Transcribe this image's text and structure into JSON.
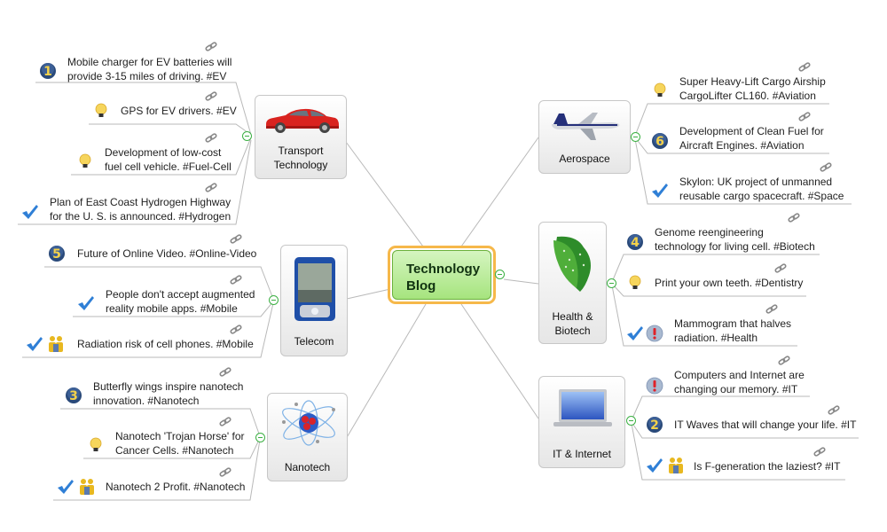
{
  "central": {
    "title_line1": "Technology",
    "title_line2": "Blog"
  },
  "topics": {
    "transport": {
      "label_line1": "Transport",
      "label_line2": "Technology",
      "image": "red-car",
      "items": [
        {
          "line1": "Mobile charger for EV batteries will",
          "line2": "provide 3-15 miles of driving. #EV",
          "icons": [
            "priority-1"
          ]
        },
        {
          "line1": "GPS for EV drivers. #EV",
          "icons": [
            "idea-bulb"
          ]
        },
        {
          "line1": "Development of low-cost",
          "line2": "fuel cell vehicle. #Fuel-Cell",
          "icons": [
            "idea-bulb"
          ]
        },
        {
          "line1": "Plan of East Coast Hydrogen Highway",
          "line2": "for the U. S. is announced. #Hydrogen",
          "icons": [
            "checkmark"
          ]
        }
      ]
    },
    "telecom": {
      "label_line1": "Telecom",
      "image": "pda-device",
      "items": [
        {
          "line1": "Future of Online Video. #Online-Video",
          "icons": [
            "priority-5"
          ]
        },
        {
          "line1": "People don't accept augmented",
          "line2": "reality mobile apps. #Mobile",
          "icons": [
            "checkmark"
          ]
        },
        {
          "line1": "Radiation risk of cell phones. #Mobile",
          "icons": [
            "checkmark",
            "people"
          ]
        }
      ]
    },
    "nanotech": {
      "label_line1": "Nanotech",
      "image": "atom",
      "items": [
        {
          "line1": "Butterfly wings inspire nanotech",
          "line2": "innovation. #Nanotech",
          "icons": [
            "priority-3"
          ]
        },
        {
          "line1": "Nanotech 'Trojan Horse' for",
          "line2": "Cancer Cells. #Nanotech",
          "icons": [
            "idea-bulb"
          ]
        },
        {
          "line1": "Nanotech 2 Profit. #Nanotech",
          "icons": [
            "checkmark",
            "people"
          ]
        }
      ]
    },
    "aerospace": {
      "label_line1": "Aerospace",
      "image": "airplane",
      "items": [
        {
          "line1": "Super Heavy-Lift Cargo Airship",
          "line2": "CargoLifter CL160. #Aviation",
          "icons": [
            "idea-bulb"
          ]
        },
        {
          "line1": "Development of Clean Fuel for",
          "line2": "Aircraft Engines. #Aviation",
          "icons": [
            "priority-6"
          ]
        },
        {
          "line1": "Skylon: UK project of unmanned",
          "line2": "reusable cargo spacecraft. #Space",
          "icons": [
            "checkmark"
          ]
        }
      ]
    },
    "health": {
      "label_line1": "Health &",
      "label_line2": "Biotech",
      "image": "green-leaves",
      "items": [
        {
          "line1": "Genome reengineering",
          "line2": "technology for living cell. #Biotech",
          "icons": [
            "priority-4"
          ]
        },
        {
          "line1": "Print your own teeth. #Dentistry",
          "icons": [
            "idea-bulb"
          ]
        },
        {
          "line1": "Mammogram that halves",
          "line2": "radiation. #Health",
          "icons": [
            "checkmark",
            "alert"
          ]
        }
      ]
    },
    "it": {
      "label_line1": "IT & Internet",
      "image": "laptop",
      "items": [
        {
          "line1": "Computers and Internet are",
          "line2": "changing our memory. #IT",
          "icons": [
            "alert"
          ]
        },
        {
          "line1": "IT Waves that will change your life. #IT",
          "icons": [
            "priority-2"
          ]
        },
        {
          "line1": "Is F-generation the laziest? #IT",
          "icons": [
            "checkmark",
            "people"
          ]
        }
      ]
    }
  },
  "numbers": {
    "p1": "1",
    "p2": "2",
    "p3": "3",
    "p4": "4",
    "p5": "5",
    "p6": "6"
  },
  "colors": {
    "central_fill": "#b8ea92",
    "central_border": "#f6b84a",
    "connector": "#b5b5b5",
    "collapse": "#3cb043"
  }
}
